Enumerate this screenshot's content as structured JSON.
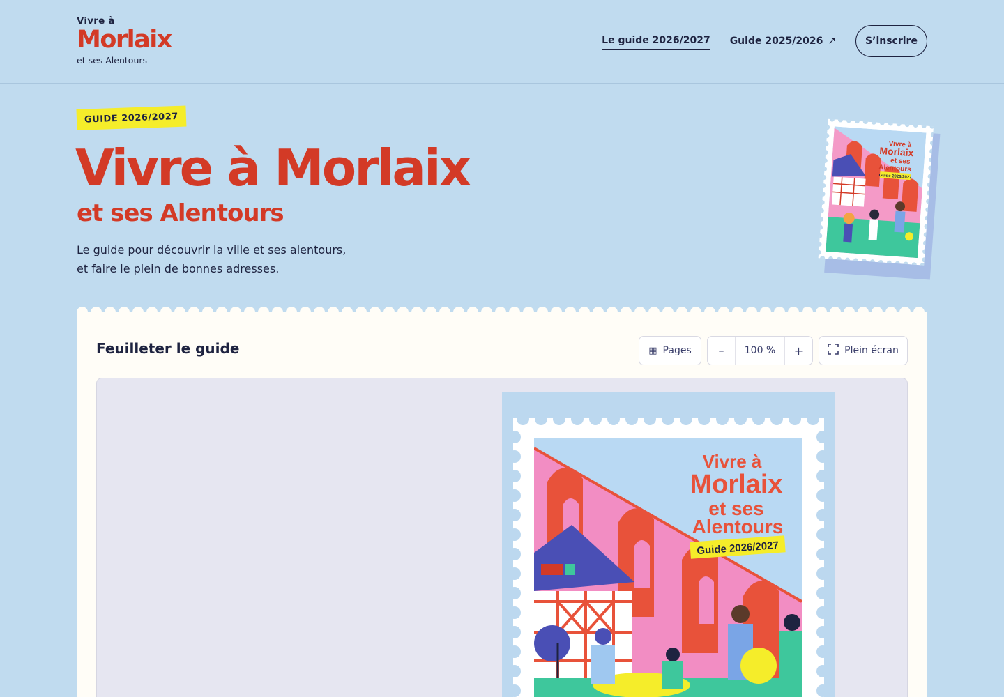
{
  "header": {
    "logo_line1": "Vivre à",
    "logo_line2": "Morlaix",
    "logo_line3": "et ses Alentours",
    "nav": [
      {
        "label": "Le guide 2026/2027",
        "active": true
      },
      {
        "label": "Guide 2025/2026",
        "external_icon": "↗"
      }
    ],
    "cta_label": "S’inscrire"
  },
  "hero": {
    "badge": "GUIDE 2026/2027",
    "title": "Vivre à Morlaix",
    "subtitle": "et ses Alentours",
    "description_line1": "Le guide pour découvrir la ville et ses alentours,",
    "description_line2": "et faire le plein de bonnes adresses."
  },
  "cover": {
    "line1": "Vivre à",
    "line2": "Morlaix",
    "line3": "et ses",
    "line4": "Alentours",
    "badge": "Guide 2026/2027"
  },
  "viewer": {
    "title": "Feuilleter le guide",
    "pages_label": "Pages",
    "pages_icon": "grid-icon",
    "zoom_minus": "–",
    "zoom_value": "100 %",
    "zoom_plus": "+",
    "fullscreen_label": "Plein écran",
    "fullscreen_icon": "fullscreen-icon"
  },
  "colors": {
    "background": "#c0dbef",
    "brand_red": "#d33a26",
    "navy": "#1e2340",
    "badge_yellow": "#f5ed2a",
    "card_bg": "#fffdf7",
    "viewer_bg": "#e6e6f1"
  }
}
